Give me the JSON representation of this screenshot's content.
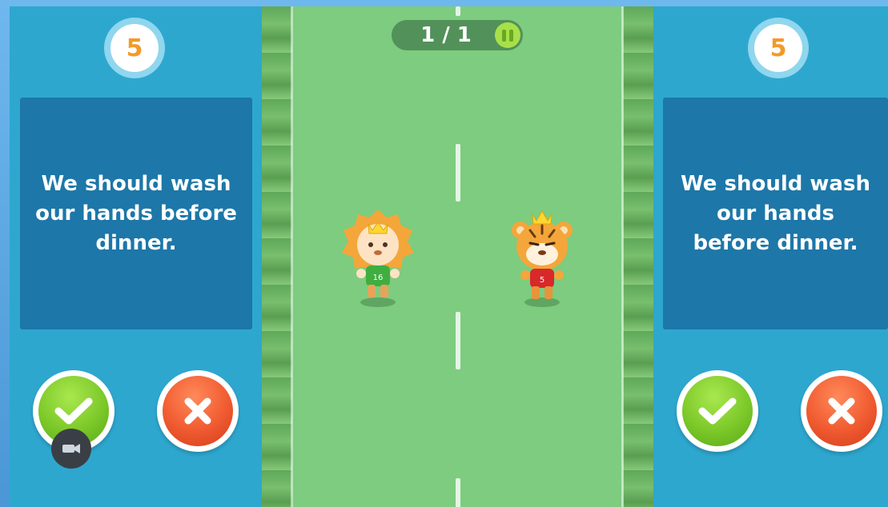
{
  "progress": {
    "text": "1 / 1"
  },
  "left_panel": {
    "score": "5",
    "question": "We should wash our hands before dinner."
  },
  "right_panel": {
    "score": "5",
    "question": "We should wash our hands before dinner."
  },
  "players": [
    {
      "name": "lion",
      "jersey": "16",
      "jersey_color": "#3fae3f"
    },
    {
      "name": "tiger",
      "jersey": "5",
      "jersey_color": "#d8282a"
    }
  ],
  "colors": {
    "panel": "#2ea7cf",
    "question_box": "#1d77a8",
    "field": "#7dcc7f",
    "score_text": "#f29a2a",
    "check": "#7cc829",
    "cross": "#f05a30"
  },
  "icons": {
    "pause": "pause-icon",
    "check": "check-icon",
    "cross": "cross-icon",
    "overlay": "camera-icon"
  }
}
